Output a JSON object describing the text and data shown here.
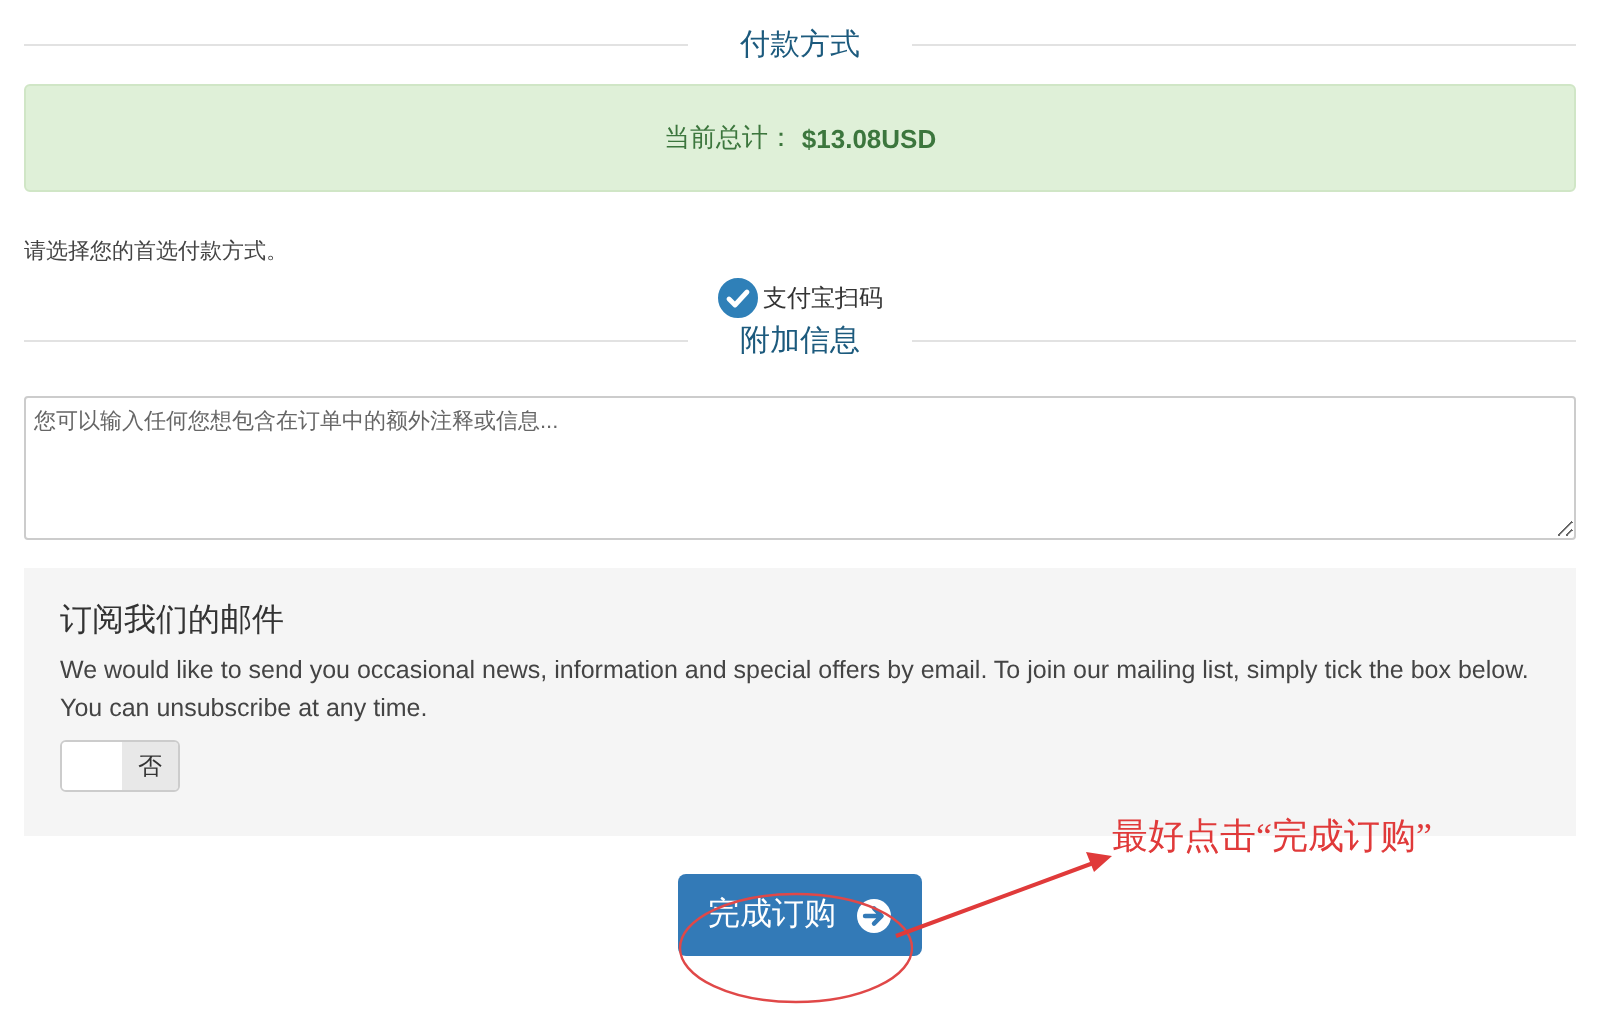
{
  "payment_section": {
    "title": "付款方式"
  },
  "total": {
    "label": "当前总计：",
    "amount": "$13.08USD"
  },
  "payment_prompt": "请选择您的首选付款方式。",
  "payment_options": [
    {
      "label": "支付宝扫码",
      "checked": true
    }
  ],
  "notes_section": {
    "title": "附加信息"
  },
  "notes_field": {
    "placeholder": "您可以输入任何您想包含在订单中的额外注释或信息..."
  },
  "newsletter": {
    "title": "订阅我们的邮件",
    "text": "We would like to send you occasional news, information and special offers by email. To join our mailing list, simply tick the box below. You can unsubscribe at any time.",
    "toggle": {
      "label": "否",
      "on": false
    }
  },
  "submit_button": {
    "label": "完成订购"
  },
  "annotation": {
    "text": "最好点击“完成订购”"
  }
}
